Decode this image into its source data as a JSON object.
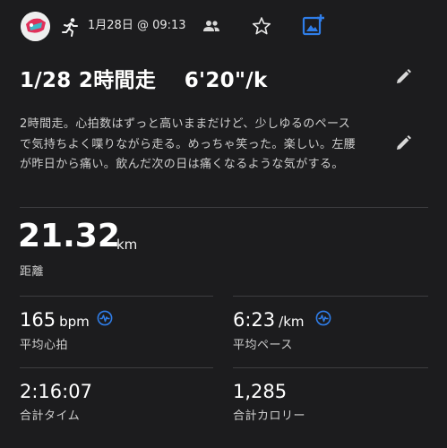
{
  "header": {
    "date": "1月28日 @ 09:13",
    "icons": [
      "avatar",
      "running-icon",
      "people-icon",
      "star-icon",
      "add-photo-icon"
    ]
  },
  "activity": {
    "title": "1/28 2時間走　 6'20\"/k",
    "description": "2時間走。心拍数はずっと高いままだけど、少しゆるのペースで気持ちよく喋りながら走る。めっちゃ笑った。楽しい。左腰が昨日から痛い。飲んだ次の日は痛くなるような気がする。"
  },
  "stats": {
    "distance": {
      "value": "21.32",
      "unit": "km",
      "label": "距離"
    },
    "heart_rate": {
      "value": "165",
      "unit": "bpm",
      "label": "平均心拍"
    },
    "pace": {
      "value": "6:23",
      "unit": "/km",
      "label": "平均ペース"
    },
    "time": {
      "value": "2:16:07",
      "label": "合計タイム"
    },
    "calories": {
      "value": "1,285",
      "label": "合計カロリー"
    }
  },
  "colors": {
    "background": "#1c1c1e",
    "accent": "#2f7de8",
    "text": "#ffffff",
    "muted": "#cfcfcf"
  }
}
